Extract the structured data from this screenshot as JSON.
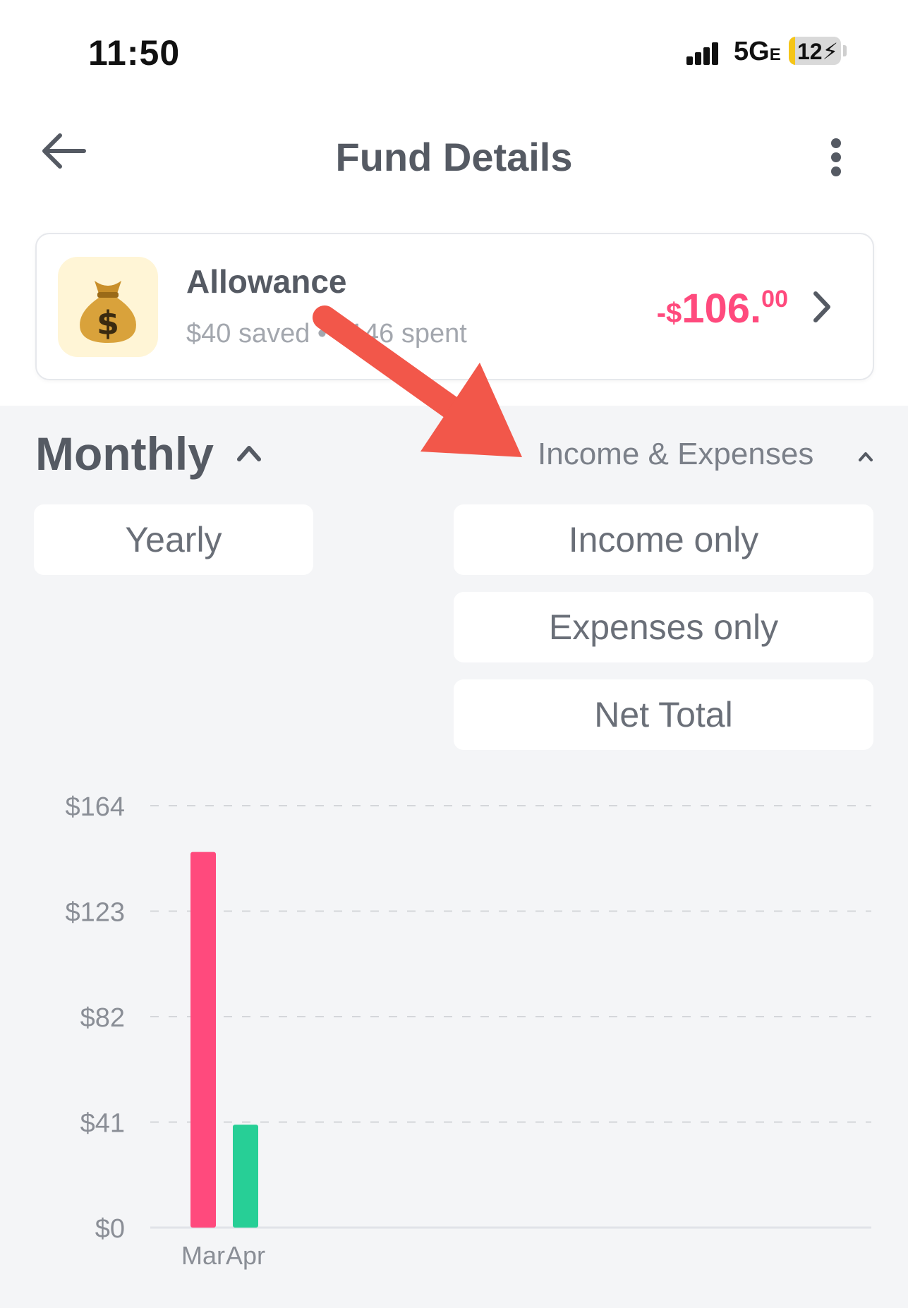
{
  "status_bar": {
    "time": "11:50",
    "network": "5G",
    "network_suffix": "E",
    "battery_level": "12",
    "battery_fraction": 0.12
  },
  "header": {
    "title": "Fund Details"
  },
  "fund": {
    "name": "Allowance",
    "summary": "$40 saved • $146 spent",
    "balance_prefix": "-$",
    "balance_whole": "106.",
    "balance_cents": "00",
    "icon": "money-bag-icon"
  },
  "filters": {
    "period_label": "Monthly",
    "period_options": [
      "Yearly"
    ],
    "mode_label": "Income & Expenses",
    "mode_options": [
      "Income only",
      "Expenses only",
      "Net Total"
    ]
  },
  "colors": {
    "expense": "#ff4a7d",
    "income": "#27cf96",
    "accent_arrow": "#f2574a"
  },
  "chart_data": {
    "type": "bar",
    "categories": [
      "Mar",
      "Apr"
    ],
    "series": [
      {
        "values": [
          146,
          0
        ]
      },
      {
        "values": [
          0,
          40
        ]
      }
    ],
    "y_ticks": [
      "$164",
      "$123",
      "$82",
      "$41",
      "$0"
    ],
    "ylim": [
      0,
      164
    ],
    "grid": true
  }
}
